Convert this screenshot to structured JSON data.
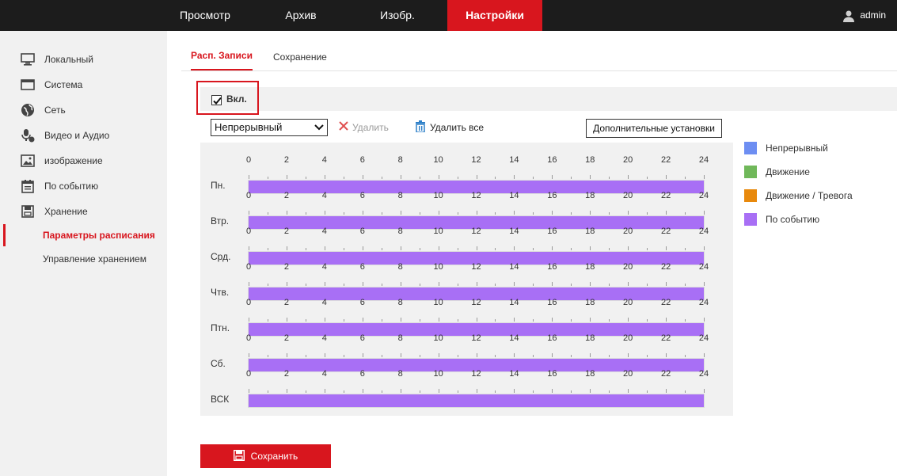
{
  "topnav": {
    "tabs": [
      {
        "label": "Просмотр",
        "active": false
      },
      {
        "label": "Архив",
        "active": false
      },
      {
        "label": "Изобр.",
        "active": false
      },
      {
        "label": "Настройки",
        "active": true
      }
    ],
    "user": "admin"
  },
  "sidebar": {
    "items": [
      {
        "label": "Локальный",
        "icon": "monitor-icon"
      },
      {
        "label": "Система",
        "icon": "window-icon"
      },
      {
        "label": "Сеть",
        "icon": "globe-icon"
      },
      {
        "label": "Видео и Аудио",
        "icon": "mic-icon"
      },
      {
        "label": "изображение",
        "icon": "image-icon"
      },
      {
        "label": "По событию",
        "icon": "calendar-icon"
      },
      {
        "label": "Хранение",
        "icon": "storage-icon"
      }
    ],
    "subitems": [
      {
        "label": "Параметры расписания",
        "active": true
      },
      {
        "label": "Управление хранением",
        "active": false
      }
    ]
  },
  "subtabs": [
    {
      "label": "Расп. Записи",
      "active": true
    },
    {
      "label": "Сохранение",
      "active": false
    }
  ],
  "enable": {
    "label": "Вкл.",
    "checked": true
  },
  "toolbar": {
    "record_type": "Непрерывный",
    "delete_label": "Удалить",
    "delete_all_label": "Удалить все",
    "advanced_label": "Дополнительные установки"
  },
  "schedule": {
    "hour_ticks": [
      "0",
      "2",
      "4",
      "6",
      "8",
      "10",
      "12",
      "14",
      "16",
      "18",
      "20",
      "22",
      "24"
    ],
    "days": [
      {
        "name": "Пн.",
        "type": "По событию",
        "from_hour": 0,
        "to_hour": 24
      },
      {
        "name": "Втр.",
        "type": "По событию",
        "from_hour": 0,
        "to_hour": 24
      },
      {
        "name": "Срд.",
        "type": "По событию",
        "from_hour": 0,
        "to_hour": 24
      },
      {
        "name": "Чтв.",
        "type": "По событию",
        "from_hour": 0,
        "to_hour": 24
      },
      {
        "name": "Птн.",
        "type": "По событию",
        "from_hour": 0,
        "to_hour": 24
      },
      {
        "name": "Сб.",
        "type": "По событию",
        "from_hour": 0,
        "to_hour": 24
      },
      {
        "name": "ВСК",
        "type": "По событию",
        "from_hour": 0,
        "to_hour": 24
      }
    ]
  },
  "legend": [
    {
      "label": "Непрерывный",
      "color": "#6d8ef2"
    },
    {
      "label": "Движение",
      "color": "#70b85a"
    },
    {
      "label": "Движение / Тревога",
      "color": "#e8890c"
    },
    {
      "label": "По событию",
      "color": "#a86ff5"
    }
  ],
  "save_label": "Сохранить",
  "colors": {
    "accent": "#d8161e",
    "topbar": "#1c1c1c",
    "sidebar": "#f1f1f1"
  }
}
